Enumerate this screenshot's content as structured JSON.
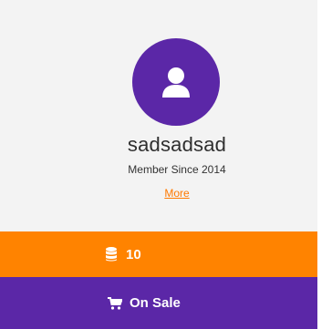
{
  "profile": {
    "username": "sadsadsad",
    "member_since": "Member Since 2014",
    "more_link": "More"
  },
  "stats": {
    "coins_icon": "database-icon",
    "coins_value": "10"
  },
  "on_sale": {
    "icon": "shopping-cart-icon",
    "label": "On Sale"
  },
  "colors": {
    "purple": "#5b27a7",
    "orange": "#ff8300",
    "background": "#f3f3f3"
  }
}
